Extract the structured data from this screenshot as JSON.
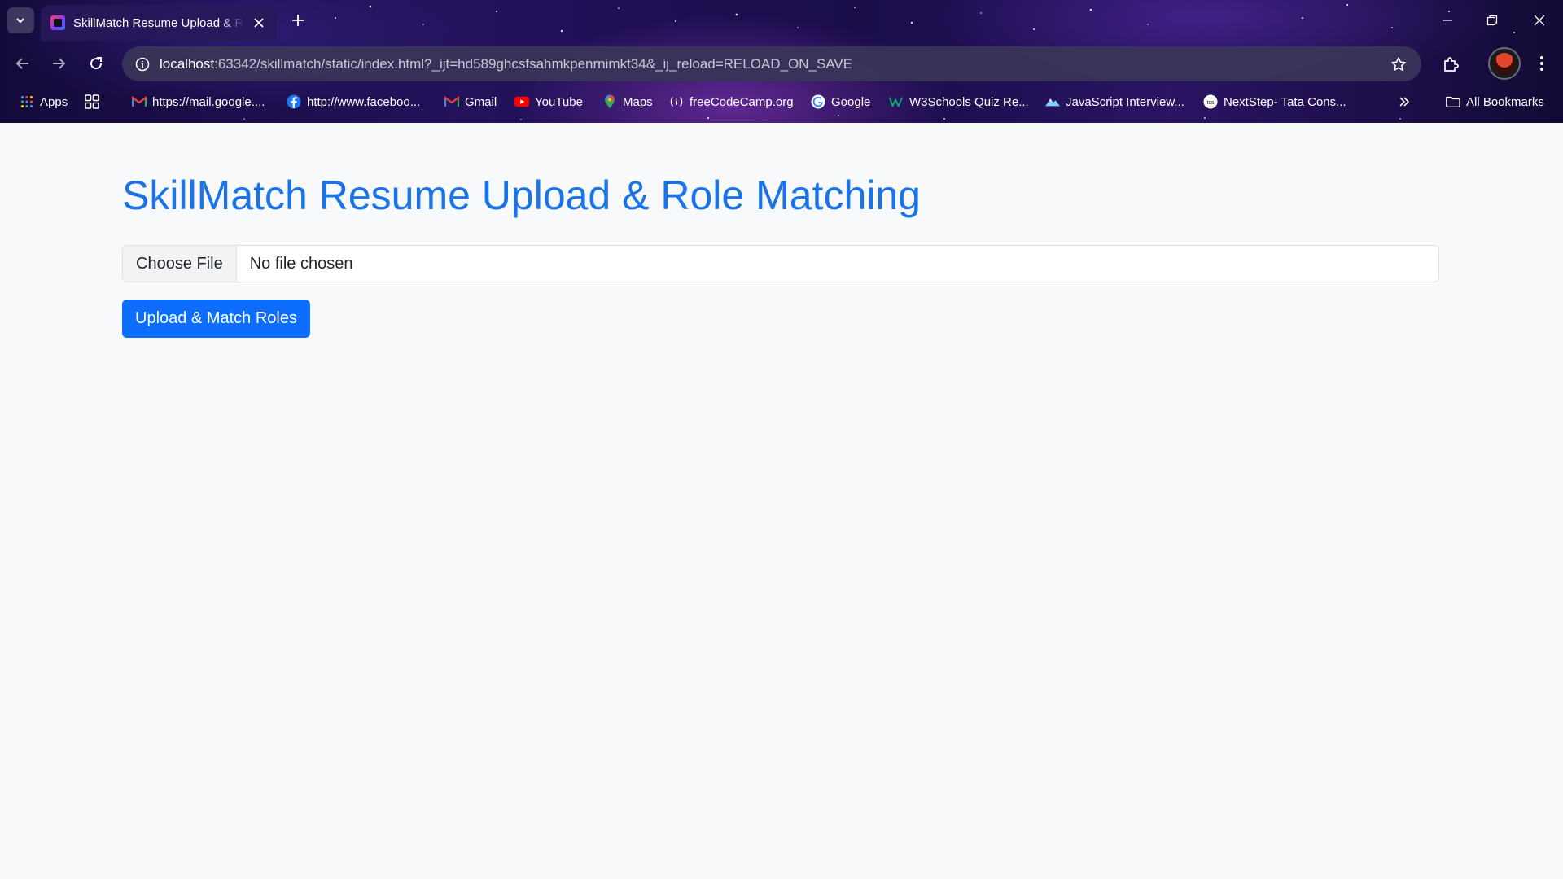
{
  "browser": {
    "tab_title": "SkillMatch Resume Upload & Role Matching",
    "url_host": "localhost",
    "url_rest": ":63342/skillmatch/static/index.html?_ijt=hd589ghcsfsahmkpenrnimkt34&_ij_reload=RELOAD_ON_SAVE",
    "bookmarks": [
      {
        "label": "Apps",
        "icon": "apps-grid-icon"
      },
      {
        "label": "",
        "icon": "tab-groups-icon"
      },
      {
        "label": "https://mail.google....",
        "icon": "gmail-icon"
      },
      {
        "label": "http://www.faceboo...",
        "icon": "facebook-icon"
      },
      {
        "label": "Gmail",
        "icon": "gmail-icon"
      },
      {
        "label": "YouTube",
        "icon": "youtube-icon"
      },
      {
        "label": "Maps",
        "icon": "maps-pin-icon"
      },
      {
        "label": "freeCodeCamp.org",
        "icon": "freecodecamp-icon"
      },
      {
        "label": "Google",
        "icon": "google-icon"
      },
      {
        "label": "W3Schools Quiz Re...",
        "icon": "w3schools-icon"
      },
      {
        "label": "JavaScript Interview...",
        "icon": "mountain-icon"
      },
      {
        "label": "NextStep- Tata Cons...",
        "icon": "tcs-icon"
      }
    ],
    "all_bookmarks_label": "All Bookmarks",
    "colors": {
      "accent": "#1a73e8",
      "button": "#0d6efd"
    }
  },
  "page": {
    "title": "SkillMatch Resume Upload & Role Matching",
    "file_button_label": "Choose File",
    "file_status": "No file chosen",
    "submit_label": "Upload & Match Roles"
  }
}
